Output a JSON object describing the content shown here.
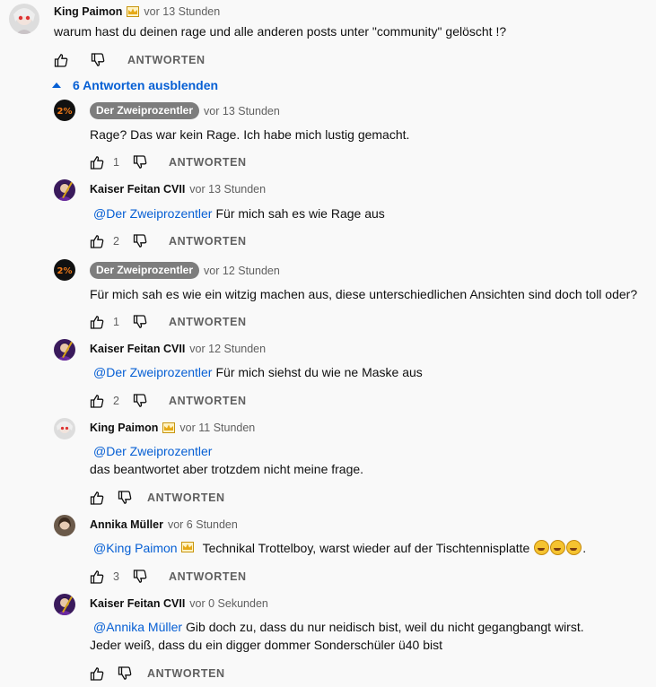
{
  "top_comment": {
    "author": "King Paimon",
    "time": "vor 13 Stunden",
    "text": "warum hast du deinen rage und alle anderen posts unter \"community\" gelöscht !?",
    "reply_label": "ANTWORTEN"
  },
  "replies_toggle": {
    "label": "6 Antworten ausblenden"
  },
  "replies": [
    {
      "author": "Der Zweiprozentler",
      "time": "vor 13 Stunden",
      "mention": "",
      "text": "Rage? Das war kein Rage. Ich habe mich lustig gemacht.",
      "line2": "",
      "likes": "1",
      "reply_label": "ANTWORTEN"
    },
    {
      "author": "Kaiser Feitan CVII",
      "time": "vor 13 Stunden",
      "mention": "@Der Zweiprozentler",
      "text": "Für mich sah es wie Rage aus",
      "line2": "",
      "likes": "2",
      "reply_label": "ANTWORTEN"
    },
    {
      "author": "Der Zweiprozentler",
      "time": "vor 12 Stunden",
      "mention": "",
      "text": "Für mich sah es wie ein witzig machen aus, diese unterschiedlichen Ansichten sind doch toll oder?",
      "line2": "",
      "likes": "1",
      "reply_label": "ANTWORTEN"
    },
    {
      "author": "Kaiser Feitan CVII",
      "time": "vor 12 Stunden",
      "mention": "@Der Zweiprozentler",
      "text": "Für mich siehst du wie ne Maske aus",
      "line2": "",
      "likes": "2",
      "reply_label": "ANTWORTEN"
    },
    {
      "author": "King Paimon",
      "time": "vor 11 Stunden",
      "mention": "@Der Zweiprozentler",
      "text": "",
      "line2": "das beantwortet aber trotzdem nicht meine frage.",
      "likes": "",
      "reply_label": "ANTWORTEN"
    },
    {
      "author": "Annika Müller",
      "time": "vor 6 Stunden",
      "mention": "@King Paimon",
      "text": "Technikal Trottelboy, warst wieder auf der Tischtennisplatte",
      "line2": "",
      "likes": "3",
      "reply_label": "ANTWORTEN"
    },
    {
      "author": "Kaiser Feitan CVII",
      "time": "vor 0 Sekunden",
      "mention": "@Annika Müller",
      "text": "Gib doch zu, dass du nur neidisch bist, weil du nicht gegangbangt wirst.",
      "line2": "Jeder weiß, dass du ein digger dommer Sonderschüler ü40 bist",
      "likes": "",
      "reply_label": "ANTWORTEN"
    }
  ],
  "annika_suffix": ".",
  "zwei_avatar_text": "2%",
  "icons": {
    "like": "thumbs-up-icon",
    "dislike": "thumbs-down-icon",
    "crown": "crown-icon",
    "emoji": "rofl-emoji-icon"
  }
}
